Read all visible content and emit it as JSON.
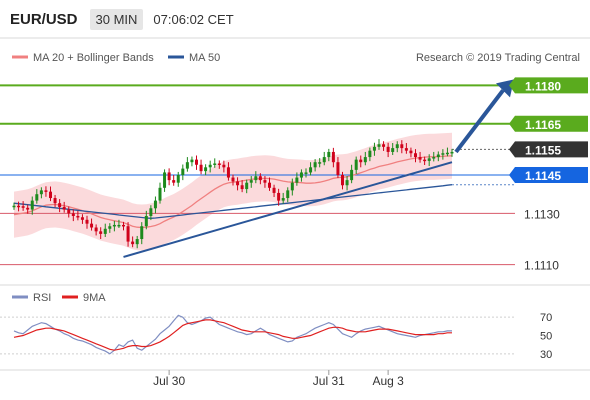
{
  "header": {
    "symbol": "EUR/USD",
    "timeframe": "30 MIN",
    "time": "07:06:02 CET"
  },
  "legend": {
    "bb_label": "MA 20 + Bollinger Bands",
    "ma50_label": "MA 50",
    "copyright": "Research © 2019 Trading Central"
  },
  "rsi_legend": {
    "rsi_label": "RSI",
    "ma_label": "9MA"
  },
  "colors": {
    "candle_up": "#1d8a1d",
    "candle_down": "#d0021b",
    "band_fill": "#f9cdd0",
    "ma20": "#f08080",
    "ma50": "#2a5699",
    "trend": "#2a5699",
    "resistance": "#5aab1e",
    "support": "#d85a6a",
    "pivot": "#333333",
    "current": "#1565e0",
    "rsi": "#7f8ec2",
    "rsi_ma": "#e02020"
  },
  "chart_data": [
    {
      "type": "candlestick",
      "title": "EUR/USD",
      "timeframe": "30 MIN",
      "ylim": [
        1.1104,
        1.1186
      ],
      "date_labels": [
        {
          "label": "Jul 30",
          "bar": 34
        },
        {
          "label": "Jul 31",
          "bar": 69
        },
        {
          "label": "Aug 3",
          "bar": 82
        }
      ],
      "levels": [
        {
          "value": 1.118,
          "label": "1.1180",
          "kind": "resistance"
        },
        {
          "value": 1.1165,
          "label": "1.1165",
          "kind": "resistance"
        },
        {
          "value": 1.1155,
          "label": "1.1155",
          "kind": "pivot"
        },
        {
          "value": 1.1145,
          "label": "1.1145",
          "kind": "current"
        },
        {
          "value": 1.113,
          "label": "1.1130",
          "kind": "support"
        },
        {
          "value": 1.111,
          "label": "1.1110",
          "kind": "support"
        }
      ],
      "series": [
        {
          "name": "Close",
          "values": [
            1.1133,
            1.11328,
            1.11322,
            1.11315,
            1.1135,
            1.11375,
            1.1139,
            1.11385,
            1.1136,
            1.1134,
            1.11325,
            1.11315,
            1.113,
            1.1129,
            1.11285,
            1.11275,
            1.1126,
            1.11245,
            1.1123,
            1.1122,
            1.1124,
            1.1125,
            1.11255,
            1.11255,
            1.1125,
            1.1119,
            1.1118,
            1.112,
            1.1125,
            1.1129,
            1.1132,
            1.1135,
            1.114,
            1.1146,
            1.1143,
            1.1142,
            1.1145,
            1.11475,
            1.115,
            1.1151,
            1.1149,
            1.11465,
            1.1148,
            1.1149,
            1.11495,
            1.1149,
            1.1148,
            1.1144,
            1.11425,
            1.1141,
            1.11395,
            1.1142,
            1.1143,
            1.11445,
            1.1143,
            1.1142,
            1.114,
            1.1138,
            1.1135,
            1.1136,
            1.1139,
            1.1142,
            1.1144,
            1.1146,
            1.1146,
            1.1148,
            1.115,
            1.115,
            1.1152,
            1.1154,
            1.115,
            1.1145,
            1.1141,
            1.1143,
            1.1147,
            1.1151,
            1.115,
            1.1152,
            1.11545,
            1.1156,
            1.1157,
            1.1156,
            1.1154,
            1.11555,
            1.1157,
            1.11555,
            1.11545,
            1.11535,
            1.1152,
            1.1151,
            1.11505,
            1.11515,
            1.1152,
            1.1153,
            1.11535,
            1.11537,
            1.1154
          ]
        },
        {
          "name": "MA 20",
          "values": [
            1.11295,
            1.11298,
            1.11301,
            1.11304,
            1.1131,
            1.11318,
            1.11326,
            1.11332,
            1.11334,
            1.11335,
            1.11333,
            1.1133,
            1.11326,
            1.11321,
            1.11316,
            1.11311,
            1.11305,
            1.11298,
            1.11291,
            1.11284,
            1.11279,
            1.11275,
            1.11271,
            1.11268,
            1.11264,
            1.11257,
            1.1125,
            1.11246,
            1.11245,
            1.11246,
            1.11249,
            1.11253,
            1.1126,
            1.1127,
            1.11278,
            1.11286,
            1.11296,
            1.11307,
            1.11319,
            1.11331,
            1.11345,
            1.11358,
            1.1137,
            1.11383,
            1.11395,
            1.11405,
            1.11414,
            1.11419,
            1.11422,
            1.11424,
            1.11427,
            1.1143,
            1.11433,
            1.11435,
            1.11436,
            1.11437,
            1.11436,
            1.11434,
            1.1143,
            1.11426,
            1.11423,
            1.11422,
            1.11421,
            1.1142,
            1.11418,
            1.11418,
            1.11419,
            1.11422,
            1.11426,
            1.11431,
            1.11437,
            1.1144,
            1.11441,
            1.11443,
            1.11448,
            1.11453,
            1.11459,
            1.11465,
            1.11472,
            1.11477,
            1.11483,
            1.11487,
            1.11491,
            1.11496,
            1.11501,
            1.11505,
            1.11509,
            1.11513,
            1.11516,
            1.11518,
            1.1152,
            1.11521,
            1.11521,
            1.11522,
            1.11523,
            1.11524,
            1.11525
          ]
        },
        {
          "name": "Upper Bollinger Band",
          "values": [
            1.11385,
            1.11388,
            1.11391,
            1.11394,
            1.114,
            1.11408,
            1.11416,
            1.11422,
            1.11424,
            1.11425,
            1.11423,
            1.1142,
            1.11416,
            1.11411,
            1.11406,
            1.11401,
            1.11395,
            1.11388,
            1.11381,
            1.11374,
            1.11369,
            1.11365,
            1.11361,
            1.11358,
            1.11354,
            1.11347,
            1.1134,
            1.11336,
            1.11335,
            1.11336,
            1.11339,
            1.11343,
            1.1135,
            1.1136,
            1.11368,
            1.11376,
            1.11386,
            1.11397,
            1.11409,
            1.11421,
            1.11435,
            1.11448,
            1.1146,
            1.11473,
            1.11485,
            1.11495,
            1.11504,
            1.11509,
            1.11512,
            1.11514,
            1.11517,
            1.1152,
            1.11523,
            1.11525,
            1.11526,
            1.11527,
            1.11526,
            1.11524,
            1.1152,
            1.11516,
            1.11513,
            1.11512,
            1.11511,
            1.1151,
            1.11508,
            1.11508,
            1.11509,
            1.11512,
            1.11516,
            1.11521,
            1.11527,
            1.1153,
            1.11531,
            1.11533,
            1.11538,
            1.11543,
            1.11549,
            1.11555,
            1.11562,
            1.11567,
            1.11573,
            1.11577,
            1.11581,
            1.11586,
            1.11591,
            1.11595,
            1.11599,
            1.11603,
            1.11606,
            1.11608,
            1.1161,
            1.11611,
            1.11611,
            1.11612,
            1.11613,
            1.11614,
            1.11615
          ]
        },
        {
          "name": "Lower Bollinger Band",
          "values": [
            1.11205,
            1.11208,
            1.11211,
            1.11214,
            1.1122,
            1.11228,
            1.11236,
            1.11242,
            1.11244,
            1.11245,
            1.11243,
            1.1124,
            1.11236,
            1.11231,
            1.11226,
            1.11221,
            1.11215,
            1.11208,
            1.11201,
            1.11194,
            1.11189,
            1.11185,
            1.11181,
            1.11178,
            1.11174,
            1.11167,
            1.1116,
            1.11156,
            1.11155,
            1.11156,
            1.11159,
            1.11163,
            1.1117,
            1.1118,
            1.11188,
            1.11196,
            1.11206,
            1.11217,
            1.11229,
            1.11241,
            1.11255,
            1.11268,
            1.1128,
            1.11293,
            1.11305,
            1.11315,
            1.11324,
            1.11329,
            1.11332,
            1.11334,
            1.11337,
            1.1134,
            1.11343,
            1.11345,
            1.11346,
            1.11347,
            1.11346,
            1.11344,
            1.1134,
            1.11336,
            1.11333,
            1.11332,
            1.11331,
            1.1133,
            1.11328,
            1.11328,
            1.11329,
            1.11332,
            1.11336,
            1.11341,
            1.11347,
            1.1135,
            1.11351,
            1.11353,
            1.11358,
            1.11363,
            1.11369,
            1.11375,
            1.11382,
            1.11387,
            1.11393,
            1.11397,
            1.11401,
            1.11406,
            1.11411,
            1.11415,
            1.11419,
            1.11423,
            1.11426,
            1.11428,
            1.1143,
            1.11431,
            1.11431,
            1.11432,
            1.11433,
            1.11434,
            1.11435
          ]
        },
        {
          "name": "MA 50",
          "values": [
            1.1134,
            1.11338,
            1.11336,
            1.11334,
            1.11332,
            1.1133,
            1.11328,
            1.11326,
            1.11324,
            1.11322,
            1.1132,
            1.11318,
            1.11316,
            1.11314,
            1.11312,
            1.1131,
            1.11308,
            1.11306,
            1.11304,
            1.11302,
            1.113,
            1.11298,
            1.11296,
            1.11294,
            1.11292,
            1.1129,
            1.11288,
            1.11286,
            1.11284,
            1.11282,
            1.11281,
            1.11282,
            1.11284,
            1.11286,
            1.11288,
            1.1129,
            1.11292,
            1.11294,
            1.11296,
            1.11298,
            1.113,
            1.11302,
            1.11304,
            1.11306,
            1.11308,
            1.1131,
            1.11312,
            1.11314,
            1.11316,
            1.11318,
            1.1132,
            1.11322,
            1.11324,
            1.11326,
            1.11328,
            1.1133,
            1.11332,
            1.11334,
            1.11336,
            1.11338,
            1.1134,
            1.11342,
            1.11344,
            1.11346,
            1.11348,
            1.1135,
            1.11352,
            1.11354,
            1.11356,
            1.11358,
            1.1136,
            1.11362,
            1.11364,
            1.11366,
            1.11368,
            1.1137,
            1.11372,
            1.11374,
            1.11376,
            1.11378,
            1.1138,
            1.11382,
            1.11384,
            1.11386,
            1.11388,
            1.1139,
            1.11392,
            1.11394,
            1.11396,
            1.11398,
            1.114,
            1.11402,
            1.11404,
            1.11406,
            1.11408,
            1.1141,
            1.11412
          ]
        }
      ],
      "trendline": {
        "start_bar": 24,
        "start_value": 1.1113,
        "end_bar": 96,
        "end_value": 1.115
      },
      "projection": {
        "from_value": 1.1154,
        "to_value": 1.118,
        "direction": "up"
      }
    },
    {
      "type": "line",
      "title": "RSI",
      "ylim": [
        20,
        80
      ],
      "yticks": [
        30,
        50,
        70
      ],
      "guide_levels": [
        30,
        70
      ],
      "series": [
        {
          "name": "RSI",
          "values": [
            55,
            53,
            52,
            56,
            60,
            62,
            64,
            63,
            60,
            57,
            55,
            52,
            50,
            47,
            45,
            44,
            42,
            40,
            37,
            35,
            33,
            30,
            34,
            40,
            38,
            43,
            45,
            36,
            34,
            38,
            42,
            46,
            52,
            56,
            60,
            66,
            72,
            70,
            64,
            62,
            64,
            66,
            69,
            70,
            66,
            62,
            60,
            58,
            56,
            54,
            53,
            51,
            52,
            55,
            58,
            55,
            51,
            49,
            47,
            45,
            43,
            44,
            48,
            50,
            52,
            55,
            58,
            60,
            62,
            64,
            62,
            57,
            52,
            50,
            48,
            52,
            55,
            57,
            58,
            59,
            60,
            58,
            56,
            54,
            52,
            51,
            50,
            49,
            48,
            50,
            51,
            52,
            53,
            54,
            54,
            55,
            55
          ]
        },
        {
          "name": "9MA",
          "values": [
            48,
            49,
            50,
            52,
            54,
            56,
            57,
            58,
            58,
            57,
            56,
            55,
            53,
            51,
            49,
            47,
            45,
            43,
            41,
            39,
            37,
            35,
            34,
            35,
            36,
            38,
            39,
            39,
            38,
            38,
            39,
            41,
            43,
            46,
            49,
            53,
            57,
            61,
            63,
            64,
            65,
            66,
            67,
            67,
            66,
            65,
            64,
            62,
            60,
            58,
            56,
            55,
            54,
            54,
            54,
            54,
            53,
            52,
            51,
            49,
            48,
            47,
            47,
            48,
            49,
            50,
            52,
            54,
            56,
            58,
            59,
            59,
            58,
            56,
            55,
            54,
            54,
            54,
            55,
            56,
            57,
            57,
            57,
            56,
            55,
            54,
            53,
            52,
            51,
            51,
            51,
            51,
            51,
            52,
            52,
            53,
            53
          ]
        }
      ]
    }
  ]
}
